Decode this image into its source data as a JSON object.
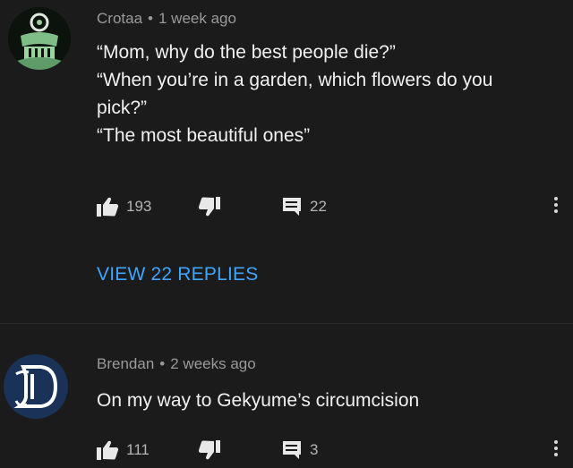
{
  "comments": [
    {
      "author": "Crotaa",
      "time": "1 week ago",
      "lines": [
        "“Mom, why do the best people die?”",
        "“When you’re in a garden, which flowers do you pick?”",
        "“The most beautiful ones”"
      ],
      "likes": "193",
      "replies": "22",
      "view_replies": "VIEW 22 REPLIES",
      "avatar_icon": "emblem-icon"
    },
    {
      "author": "Brendan",
      "time": "2 weeks ago",
      "lines": [
        "On my way to Gekyume’s circumcision"
      ],
      "likes": "111",
      "replies": "3",
      "avatar_letter": "D",
      "avatar_color": "#1a3258"
    }
  ],
  "separator": "•",
  "colors": {
    "background": "#1b1b1b",
    "link": "#3ea6ff",
    "meta": "#9a9a9a"
  }
}
